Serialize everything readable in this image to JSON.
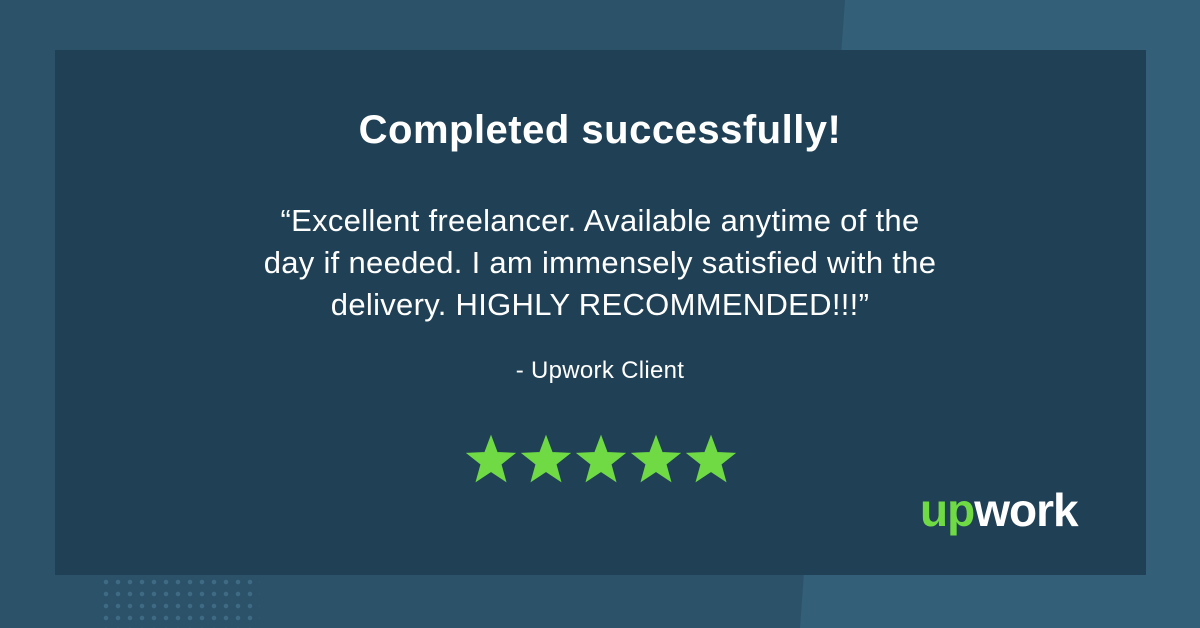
{
  "header": {
    "title": "Completed successfully!"
  },
  "review": {
    "quote_lines": [
      "“Excellent freelancer. Available anytime of the",
      "day if needed. I am immensely satisfied with the",
      "delivery. HIGHLY RECOMMENDED!!!”"
    ],
    "author": "- Upwork Client",
    "rating": 5,
    "rating_max": 5
  },
  "brand": {
    "logo_text": "upwork",
    "logo_icon": "upwork-logo",
    "star_icon": "star-icon"
  },
  "colors": {
    "background": "#2c5269",
    "background_accent": "#335f78",
    "card": "#1f4055",
    "text": "#ffffff",
    "star": "#6fda44",
    "logo_green": "#6fda44"
  }
}
